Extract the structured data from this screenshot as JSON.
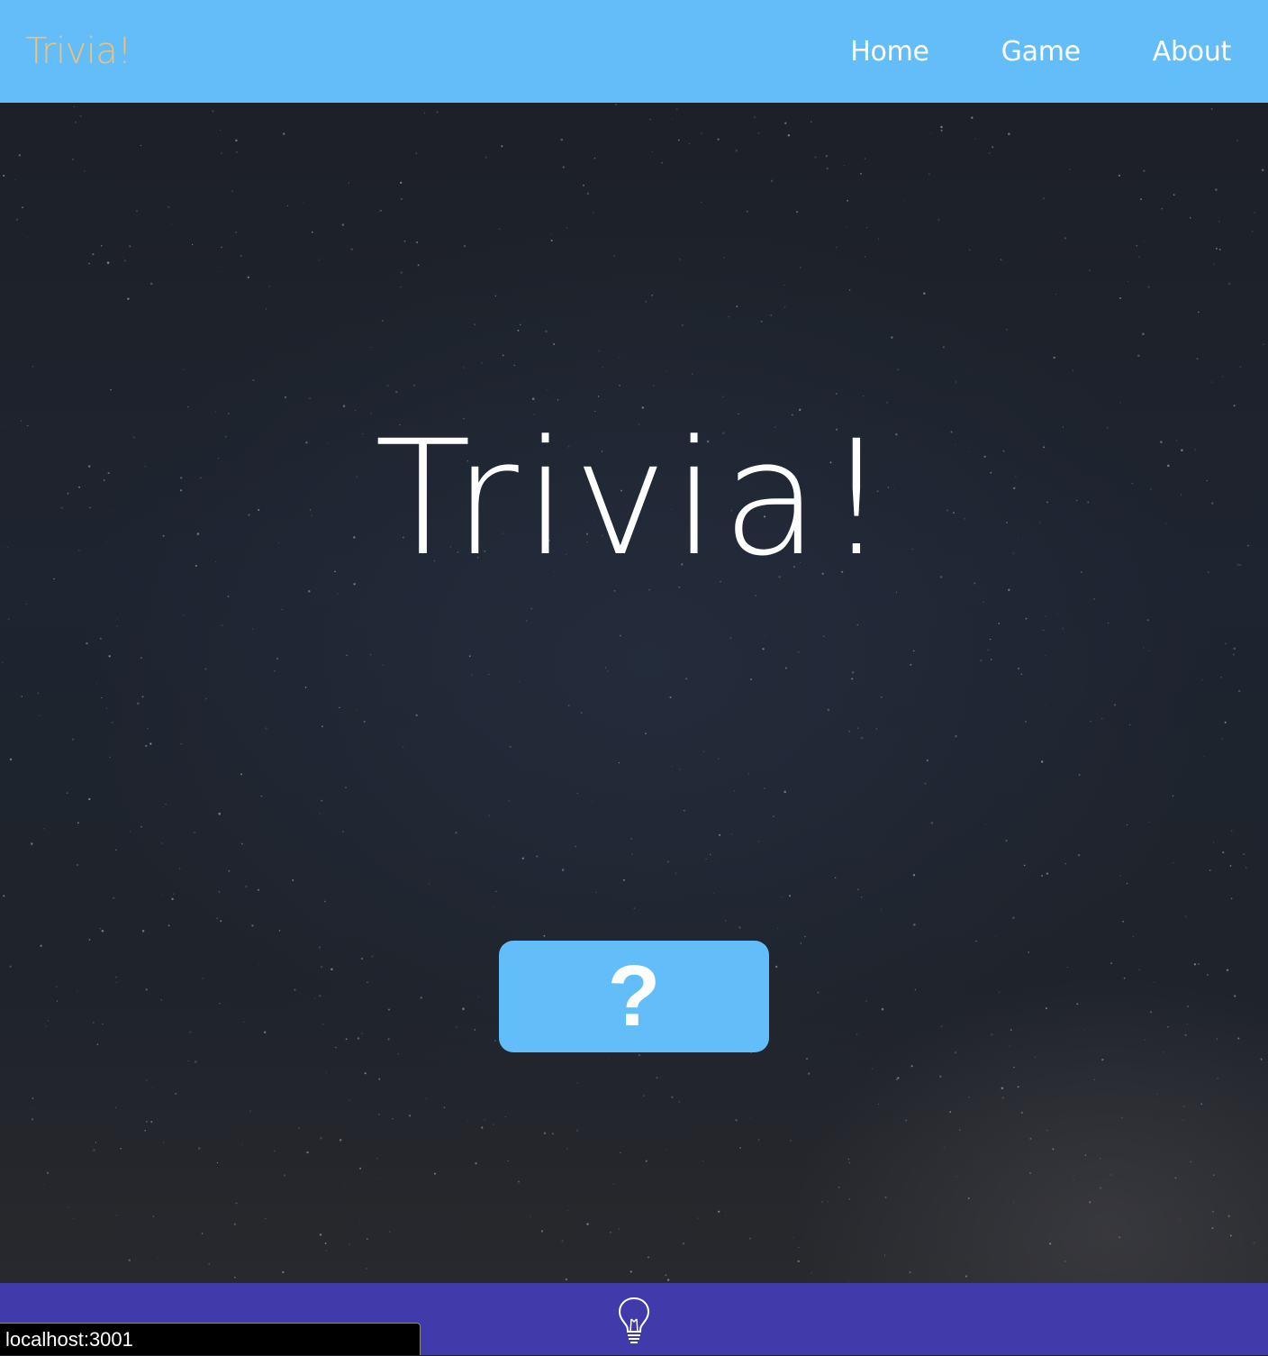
{
  "navbar": {
    "brand": "Trivia!",
    "links": [
      "Home",
      "Game",
      "About"
    ]
  },
  "hero": {
    "title": "Trivia!",
    "button_label": "?"
  },
  "footer": {
    "icon": "lightbulb-icon"
  },
  "status_bar": {
    "url": "localhost:3001"
  },
  "colors": {
    "navbar": "#63bdf8",
    "brand": "#f2c173",
    "button": "#63bdf8",
    "footer": "#413aab",
    "background": "#1f2228"
  }
}
